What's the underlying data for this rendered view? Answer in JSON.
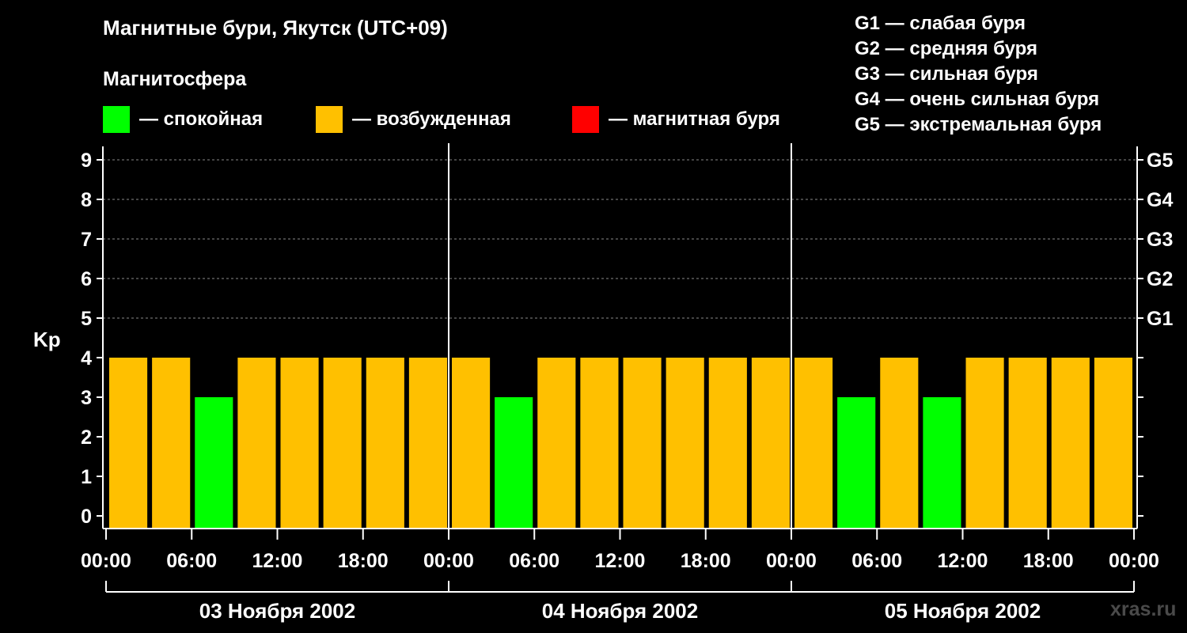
{
  "header": {
    "title": "Магнитные бури, Якутск (UTC+09)",
    "subtitle": "Магнитосфера"
  },
  "legend": [
    {
      "label": "— спокойная",
      "color": "#00ff00"
    },
    {
      "label": "— возбужденная",
      "color": "#ffc000"
    },
    {
      "label": "— магнитная буря",
      "color": "#ff0000"
    }
  ],
  "g_scale": [
    "G1 — слабая буря",
    "G2 — средняя буря",
    "G3 — сильная буря",
    "G4 — очень сильная буря",
    "G5 — экстремальная буря"
  ],
  "watermark": "xras.ru",
  "chart_data": {
    "type": "bar",
    "ylabel": "Kp",
    "ylim": [
      0,
      9
    ],
    "y_ticks": [
      0,
      1,
      2,
      3,
      4,
      5,
      6,
      7,
      8,
      9
    ],
    "right_ticks": [
      {
        "value": 5,
        "label": "G1"
      },
      {
        "value": 6,
        "label": "G2"
      },
      {
        "value": 7,
        "label": "G3"
      },
      {
        "value": 8,
        "label": "G4"
      },
      {
        "value": 9,
        "label": "G5"
      }
    ],
    "grid": true,
    "x_tick_labels": [
      "00:00",
      "06:00",
      "12:00",
      "18:00",
      "00:00",
      "06:00",
      "12:00",
      "18:00",
      "00:00",
      "06:00",
      "12:00",
      "18:00",
      "00:00"
    ],
    "days": [
      "03 Ноября 2002",
      "04 Ноября 2002",
      "05 Ноября 2002"
    ],
    "interval_hours": 3,
    "values": [
      4,
      4,
      3,
      4,
      4,
      4,
      4,
      4,
      4,
      3,
      4,
      4,
      4,
      4,
      4,
      4,
      4,
      3,
      4,
      3,
      4,
      4,
      4,
      4
    ],
    "colors": {
      "quiet": "#00ff00",
      "disturbed": "#ffc000",
      "storm": "#ff0000"
    }
  }
}
